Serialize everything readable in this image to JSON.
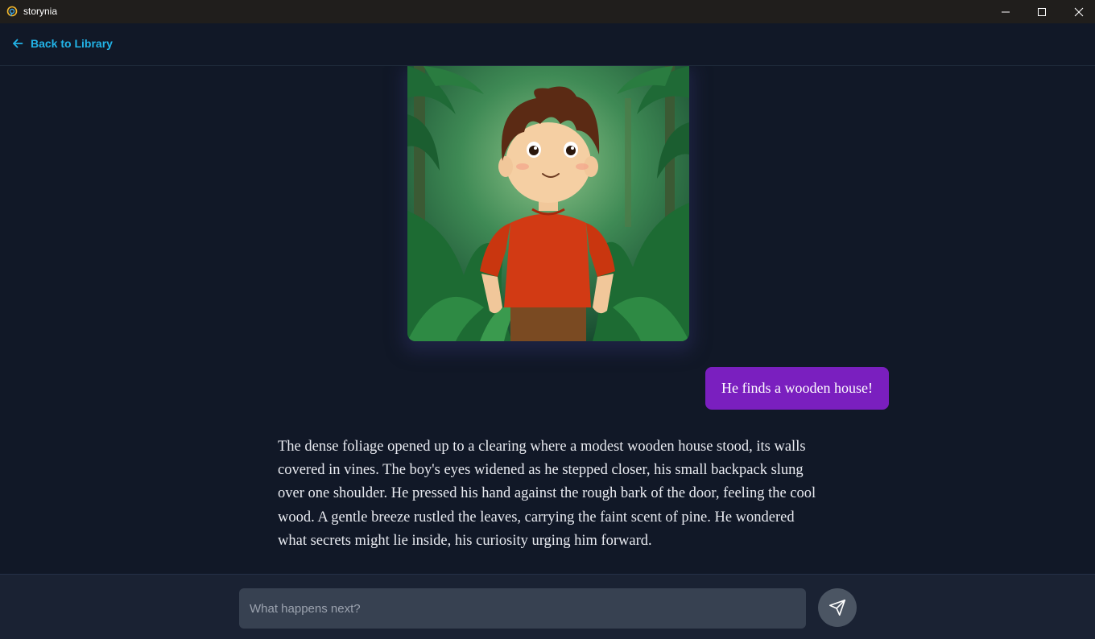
{
  "window": {
    "title": "storynia",
    "controls": [
      "minimize-icon",
      "maximize-icon",
      "close-icon"
    ]
  },
  "header": {
    "back_label": "Back to Library",
    "back_icon": "arrow-left-icon",
    "accent_color": "#22b4e8"
  },
  "story": {
    "illustration": "boy-in-jungle-illustration",
    "user_message": "He finds a wooden house!",
    "user_bubble_color": "#7a1fbf",
    "narrative": "The dense foliage opened up to a clearing where a modest wooden house stood, its walls covered in vines. The boy's eyes widened as he stepped closer, his small backpack slung over one shoulder. He pressed his hand against the rough bark of the door, feeling the cool wood. A gentle breeze rustled the leaves, carrying the faint scent of pine. He wondered what secrets might lie inside, his curiosity urging him forward."
  },
  "composer": {
    "value": "",
    "placeholder": "What happens next?",
    "send_icon": "send-icon"
  }
}
